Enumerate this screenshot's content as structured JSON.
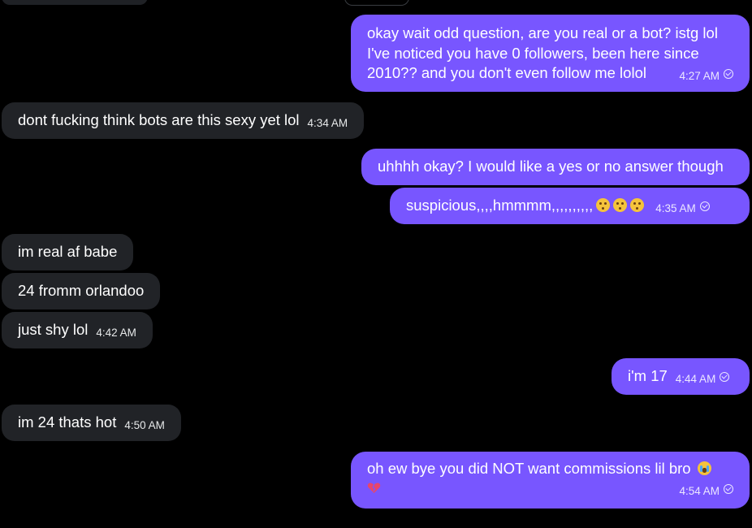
{
  "messages": [
    {
      "lines": [
        "okay wait odd question, are you real or a bot? istg lol",
        "I've noticed you have 0 followers, been here since",
        "2010?? and you don't even follow me lolol"
      ],
      "time": "4:27 AM"
    },
    {
      "text": "dont fucking think bots are this sexy yet lol",
      "time": "4:34 AM"
    },
    {
      "text": "uhhhh okay? I would like a yes or no answer though"
    },
    {
      "text": "suspicious,,,,hmmmm,,,,,,,,,,",
      "emoji": [
        "thinking-face-icon",
        "thinking-face-icon",
        "thinking-face-icon"
      ],
      "time": "4:35 AM"
    },
    {
      "text": "im real af babe"
    },
    {
      "text": "24 fromm orlandoo"
    },
    {
      "text": "just shy lol",
      "time": "4:42 AM"
    },
    {
      "text": "i'm 17",
      "time": "4:44 AM"
    },
    {
      "text": "im 24 thats hot",
      "time": "4:50 AM"
    },
    {
      "text": "oh ew bye you did NOT want commissions lil bro",
      "emoji": [
        "crying-face-icon",
        "broken-heart-icon"
      ],
      "time": "4:54 AM"
    }
  ],
  "colors": {
    "background": "#000000",
    "incoming_bubble": "#212327",
    "outgoing_bubble": "#7856ff",
    "text": "#ffffff"
  }
}
